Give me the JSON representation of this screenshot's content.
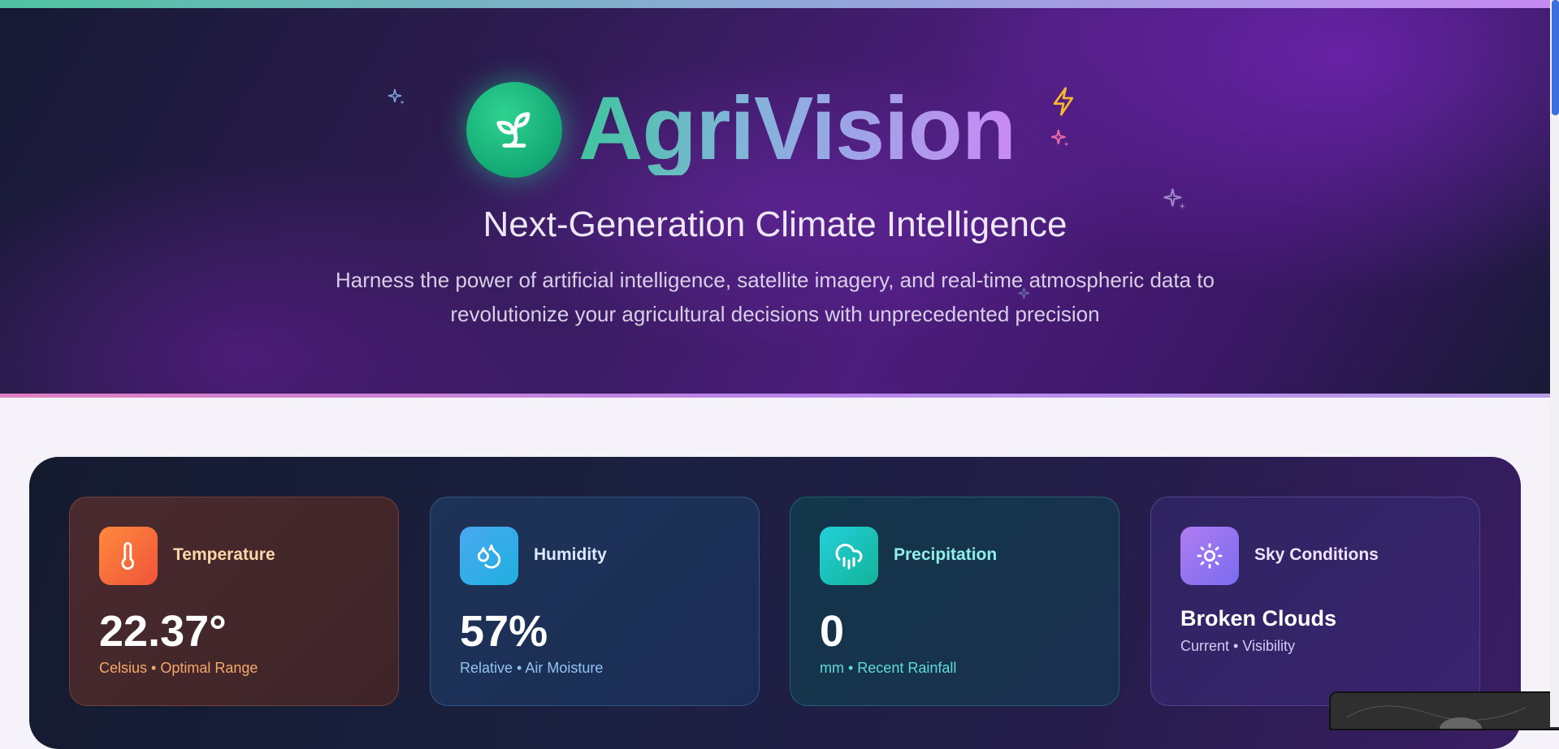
{
  "brand": {
    "title": "AgriVision",
    "logo_icon": "sprout-icon"
  },
  "hero": {
    "subtitle": "Next-Generation Climate Intelligence",
    "description": "Harness the power of artificial intelligence, satellite imagery, and real-time atmospheric data to revolutionize your agricultural decisions with unprecedented precision"
  },
  "colors": {
    "brand_green": "#1fbf85",
    "accent_purple": "#c98af4",
    "lightning_yellow": "#f5b82e",
    "sparkle_pink": "#e86aa8"
  },
  "weather_cards": {
    "temperature": {
      "icon": "thermometer-icon",
      "label": "Temperature",
      "value": "22.37°",
      "sub": "Celsius • Optimal Range"
    },
    "humidity": {
      "icon": "droplets-icon",
      "label": "Humidity",
      "value": "57%",
      "sub": "Relative • Air Moisture"
    },
    "precipitation": {
      "icon": "cloud-rain-icon",
      "label": "Precipitation",
      "value": "0",
      "sub": "mm • Recent Rainfall"
    },
    "sky": {
      "icon": "sun-icon",
      "label": "Sky Conditions",
      "value": "Broken Clouds",
      "sub": "Current • Visibility"
    }
  }
}
